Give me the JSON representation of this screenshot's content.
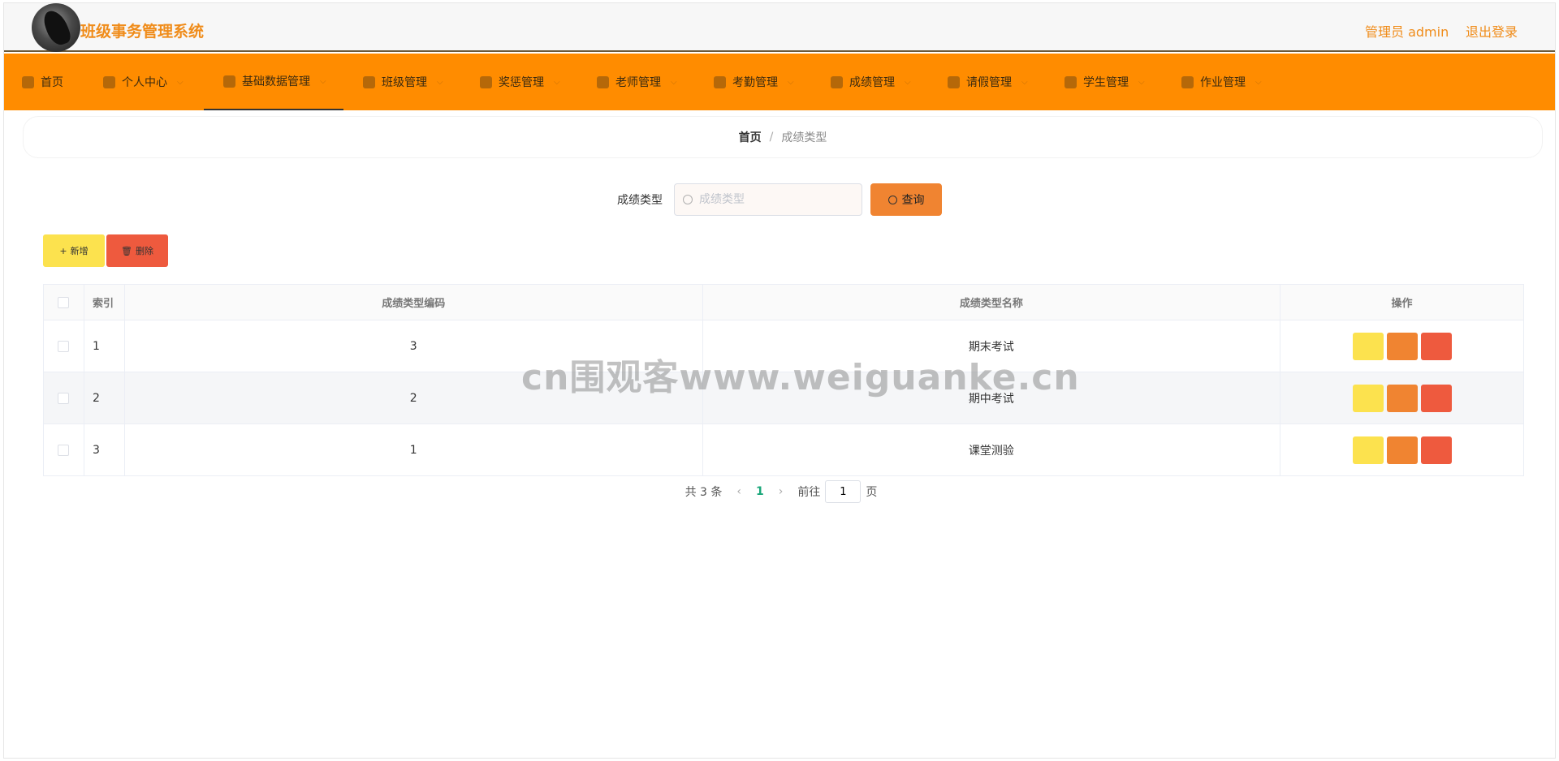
{
  "header": {
    "app_title": "班级事务管理系统",
    "user_role": "管理员 admin",
    "logout": "退出登录"
  },
  "nav": {
    "items": [
      {
        "label": "首页",
        "icon": "home-icon"
      },
      {
        "label": "个人中心",
        "icon": "user-icon"
      },
      {
        "label": "基础数据管理",
        "icon": "dashboard-icon",
        "active": true
      },
      {
        "label": "班级管理",
        "icon": "class-icon"
      },
      {
        "label": "奖惩管理",
        "icon": "award-icon"
      },
      {
        "label": "老师管理",
        "icon": "clock-icon"
      },
      {
        "label": "考勤管理",
        "icon": "clipboard-icon"
      },
      {
        "label": "成绩管理",
        "icon": "chart-icon"
      },
      {
        "label": "请假管理",
        "icon": "leave-icon"
      },
      {
        "label": "学生管理",
        "icon": "student-icon"
      },
      {
        "label": "作业管理",
        "icon": "bar-chart-icon"
      }
    ]
  },
  "breadcrumb": {
    "home": "首页",
    "separator": "/",
    "current": "成绩类型"
  },
  "search": {
    "label": "成绩类型",
    "placeholder": "成绩类型",
    "query_button": "查询"
  },
  "toolbar": {
    "add_label": "新增",
    "delete_label": "删除"
  },
  "table": {
    "headers": [
      "索引",
      "成绩类型编码",
      "成绩类型名称",
      "操作"
    ],
    "rows": [
      {
        "index": "1",
        "code": "3",
        "name": "期末考试"
      },
      {
        "index": "2",
        "code": "2",
        "name": "期中考试"
      },
      {
        "index": "3",
        "code": "1",
        "name": "课堂测验"
      }
    ]
  },
  "pagination": {
    "total": "共 3 条",
    "prev": "‹",
    "current_page": "1",
    "next": "›",
    "goto_label": "前往",
    "goto_value": "1",
    "page_suffix": "页"
  },
  "watermark": "cn围观客www.weiguanke.cn",
  "colors": {
    "brand_orange": "#ff8c00",
    "title_orange": "#f08c1a",
    "query_button": "#f08431",
    "add_button": "#fce24e",
    "delete_button": "#ee5a3e",
    "page_active": "#1aa77a"
  }
}
